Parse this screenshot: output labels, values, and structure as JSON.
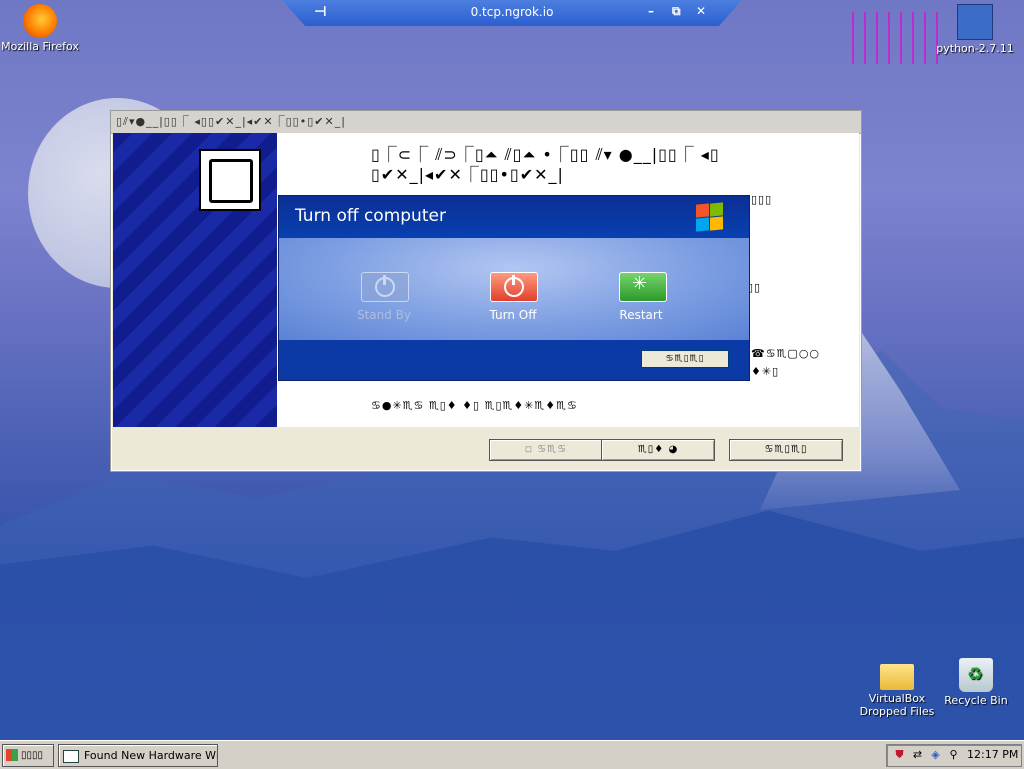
{
  "remote_bar": {
    "title": "0.tcp.ngrok.io",
    "pin_icon": "pin-icon",
    "minimize": "–",
    "restore": "⧉",
    "close": "✕"
  },
  "desktop_icons": [
    {
      "label": "Mozilla Firefox"
    },
    {
      "label": "python-2.7.11"
    },
    {
      "label": "VirtualBox Dropped Files"
    },
    {
      "label": "Recycle Bin"
    }
  ],
  "wizard": {
    "title": "▯⫽▾●__|▯▯⎾ ◂▯▯✔✕_|◂✔✕⎾▯▯•▯✔✕_|",
    "heading": "▯⎾⊂⎾ ⫽⊃⎾▯⏶ ⫽▯⏶ •⎾▯▯ ⫽▾ ●__|▯▯⎾ ◂▯ ▯✔✕_|◂✔✕⎾▯▯•▯✔✕_|",
    "line1": "▯▯▯",
    "line2": "▯▯",
    "line3": "☎♋♏▢○○",
    "line4": "♦✳▯",
    "line5": "♋●✳♏♋  ♏▯♦  ♦▯  ♏▯♏♦✳♏♦♏♋",
    "buttons": {
      "back": "◽ ♋♏♋",
      "next": "♏▯♦ ◕",
      "cancel": "♋♏▯♏▯"
    }
  },
  "turn_off": {
    "title": "Turn off computer",
    "stand_by": "Stand By",
    "turn_off": "Turn Off",
    "restart": "Restart",
    "cancel": "♋♏▯♏▯"
  },
  "taskbar": {
    "start_label": "▯▯▯▯",
    "task_button": "Found New Hardware Wi...",
    "clock": "12:17 PM"
  }
}
